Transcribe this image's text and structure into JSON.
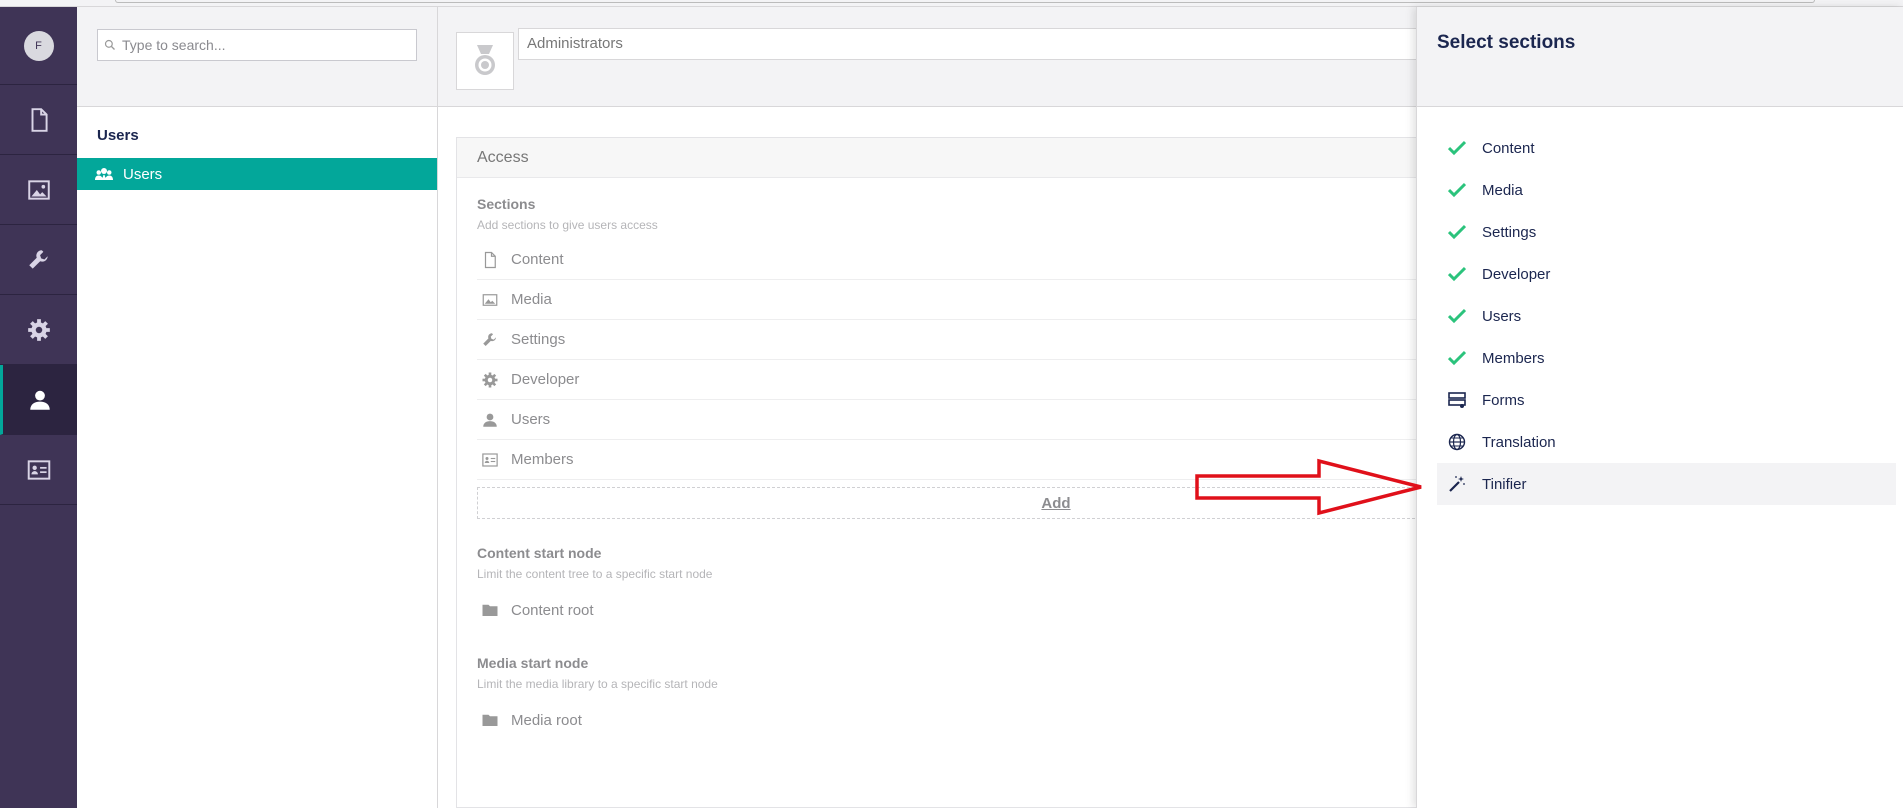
{
  "user": {
    "initial": "F"
  },
  "rail": {
    "items": [
      {
        "icon": "document-icon",
        "active": false
      },
      {
        "icon": "image-icon",
        "active": false
      },
      {
        "icon": "wrench-icon",
        "active": false
      },
      {
        "icon": "gear-icon",
        "active": false
      },
      {
        "icon": "user-icon",
        "active": true
      },
      {
        "icon": "member-card-icon",
        "active": false
      }
    ]
  },
  "tree": {
    "search_placeholder": "Type to search...",
    "title": "Users",
    "node_label": "Users"
  },
  "editor": {
    "group_name": "Administrators",
    "access_title": "Access",
    "sections": {
      "title": "Sections",
      "description": "Add sections to give users access",
      "items": [
        {
          "label": "Content",
          "icon": "document-icon"
        },
        {
          "label": "Media",
          "icon": "image-icon"
        },
        {
          "label": "Settings",
          "icon": "wrench-icon"
        },
        {
          "label": "Developer",
          "icon": "gear-icon"
        },
        {
          "label": "Users",
          "icon": "user-icon"
        },
        {
          "label": "Members",
          "icon": "member-card-icon"
        }
      ],
      "add_label": "Add"
    },
    "content_start": {
      "title": "Content start node",
      "description": "Limit the content tree to a specific start node",
      "value": "Content root"
    },
    "media_start": {
      "title": "Media start node",
      "description": "Limit the media library to a specific start node",
      "value": "Media root"
    }
  },
  "overlay": {
    "title": "Select sections",
    "items": [
      {
        "label": "Content",
        "selected": true
      },
      {
        "label": "Media",
        "selected": true
      },
      {
        "label": "Settings",
        "selected": true
      },
      {
        "label": "Developer",
        "selected": true
      },
      {
        "label": "Users",
        "selected": true
      },
      {
        "label": "Members",
        "selected": true
      },
      {
        "label": "Forms",
        "selected": false,
        "icon": "forms-icon"
      },
      {
        "label": "Translation",
        "selected": false,
        "icon": "globe-icon"
      },
      {
        "label": "Tinifier",
        "selected": false,
        "icon": "magic-wand-icon",
        "highlighted": true
      }
    ]
  },
  "colors": {
    "rail_bg": "#3f3456",
    "accent": "#03a79a",
    "check": "#2bc37c",
    "annotation_arrow": "#e0101a"
  }
}
